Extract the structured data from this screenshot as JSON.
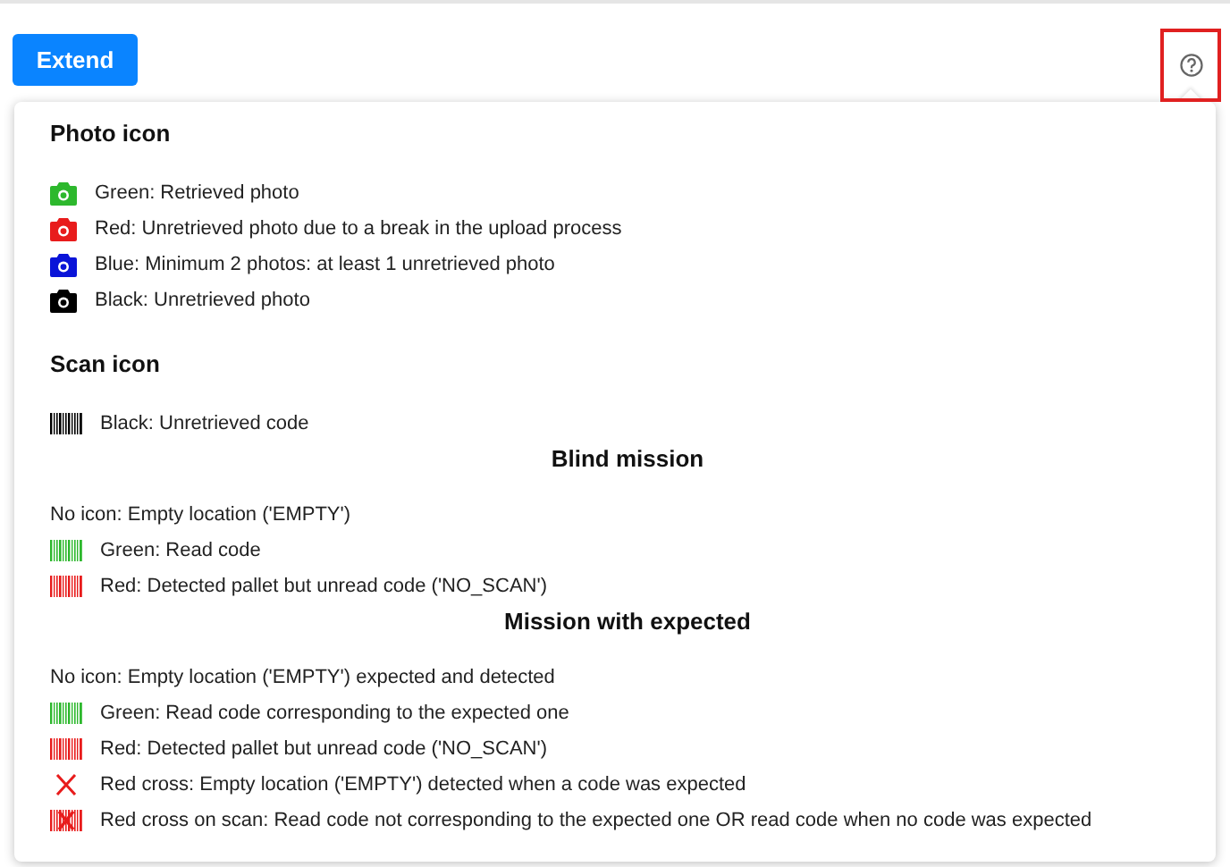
{
  "extend_button": "Extend",
  "sections": [
    {
      "kind": "category",
      "title": "Photo icon",
      "items": [
        {
          "kind": "camera",
          "color": "#2db82d",
          "text": "Green: Retrieved photo"
        },
        {
          "kind": "camera",
          "color": "#e81c1c",
          "text": "Red: Unretrieved photo due to a break in the upload process"
        },
        {
          "kind": "camera",
          "color": "#0a14d8",
          "text": "Blue: Minimum 2 photos: at least 1 unretrieved photo"
        },
        {
          "kind": "camera",
          "color": "#000000",
          "text": "Black: Unretrieved photo"
        }
      ]
    },
    {
      "kind": "category",
      "title": "Scan icon",
      "items": [
        {
          "kind": "barcode",
          "color": "#000000",
          "text": "Black: Unretrieved code"
        }
      ]
    },
    {
      "kind": "mission",
      "title": "Blind mission",
      "items": [
        {
          "kind": "none",
          "text": "No icon: Empty location ('EMPTY')"
        },
        {
          "kind": "barcode",
          "color": "#2db82d",
          "text": "Green: Read code"
        },
        {
          "kind": "barcode",
          "color": "#e81c1c",
          "text": "Red: Detected pallet but unread code ('NO_SCAN')"
        }
      ]
    },
    {
      "kind": "mission",
      "title": "Mission with expected",
      "items": [
        {
          "kind": "none",
          "text": "No icon: Empty location ('EMPTY') expected and detected"
        },
        {
          "kind": "barcode",
          "color": "#2db82d",
          "text": "Green: Read code corresponding to the expected one"
        },
        {
          "kind": "barcode",
          "color": "#e81c1c",
          "text": "Red: Detected pallet but unread code ('NO_SCAN')"
        },
        {
          "kind": "cross",
          "color": "#e81c1c",
          "text": "Red cross: Empty location ('EMPTY') detected when a code was expected"
        },
        {
          "kind": "barcode-cross",
          "color": "#e81c1c",
          "text": "Red cross on scan: Read code not corresponding to the expected one OR read code when no code was expected"
        }
      ]
    }
  ]
}
